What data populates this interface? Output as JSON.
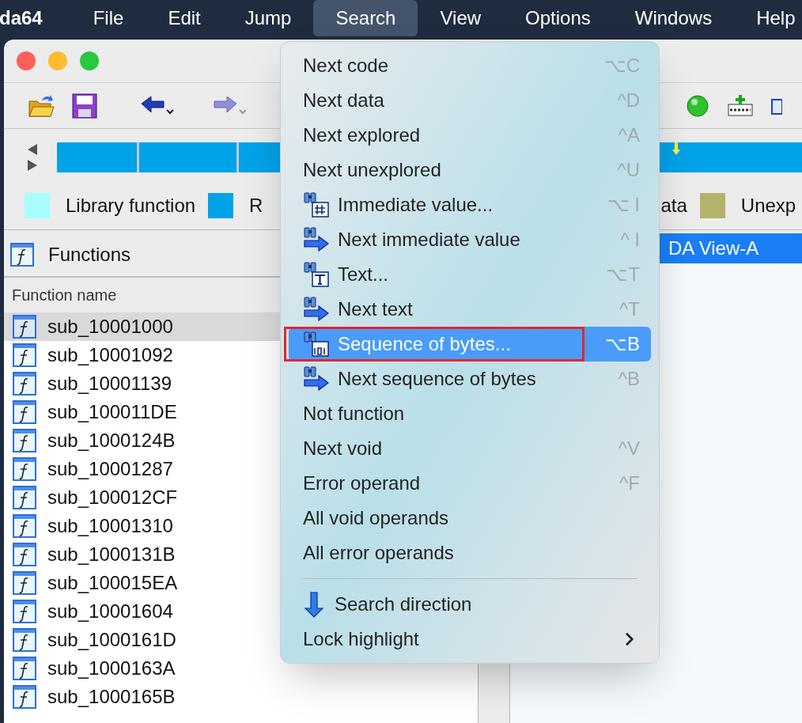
{
  "menubar": [
    {
      "label": "da64",
      "kind": "app",
      "selected": false
    },
    {
      "label": "File",
      "kind": "menu",
      "selected": false
    },
    {
      "label": "Edit",
      "kind": "menu",
      "selected": false
    },
    {
      "label": "Jump",
      "kind": "menu",
      "selected": false
    },
    {
      "label": "Search",
      "kind": "menu",
      "selected": true
    },
    {
      "label": "View",
      "kind": "menu",
      "selected": false
    },
    {
      "label": "Options",
      "kind": "menu",
      "selected": false
    },
    {
      "label": "Windows",
      "kind": "menu",
      "selected": false
    },
    {
      "label": "Help",
      "kind": "menu",
      "selected": false
    }
  ],
  "legend": [
    {
      "label": "Library function",
      "color": "#a8fdfd"
    },
    {
      "label": "R",
      "color": "#00a2e8"
    },
    {
      "label": "ata"
    },
    {
      "label": "Unexp",
      "color": "#b3b36b"
    }
  ],
  "functions_panel": {
    "title": "Functions",
    "column": "Function name",
    "rows": [
      {
        "name": "sub_10001000",
        "selected": true
      },
      {
        "name": "sub_10001092",
        "selected": false
      },
      {
        "name": "sub_10001139",
        "selected": false
      },
      {
        "name": "sub_100011DE",
        "selected": false
      },
      {
        "name": "sub_1000124B",
        "selected": false
      },
      {
        "name": "sub_10001287",
        "selected": false
      },
      {
        "name": "sub_100012CF",
        "selected": false
      },
      {
        "name": "sub_10001310",
        "selected": false
      },
      {
        "name": "sub_1000131B",
        "selected": false
      },
      {
        "name": "sub_100015EA",
        "selected": false
      },
      {
        "name": "sub_10001604",
        "selected": false
      },
      {
        "name": "sub_1000161D",
        "selected": false
      },
      {
        "name": "sub_1000163A",
        "selected": false
      },
      {
        "name": "sub_1000165B",
        "selected": false
      }
    ]
  },
  "view_tab": {
    "label": "DA View-A",
    "selected": true
  },
  "search_menu": [
    {
      "label": "Next code",
      "shortcut": "⌥C",
      "kind": "plain",
      "selected": false
    },
    {
      "label": "Next data",
      "shortcut": "^D",
      "kind": "plain",
      "selected": false
    },
    {
      "label": "Next explored",
      "shortcut": "^A",
      "kind": "plain",
      "selected": false
    },
    {
      "label": "Next unexplored",
      "shortcut": "^U",
      "kind": "plain",
      "selected": false
    },
    {
      "label": "Immediate value...",
      "shortcut": "⌥ I",
      "kind": "hash",
      "selected": false
    },
    {
      "label": "Next immediate value",
      "shortcut": "^ I",
      "kind": "next",
      "selected": false
    },
    {
      "label": "Text...",
      "shortcut": "⌥T",
      "kind": "text",
      "selected": false
    },
    {
      "label": "Next text",
      "shortcut": "^T",
      "kind": "next",
      "selected": false
    },
    {
      "label": "Sequence of bytes...",
      "shortcut": "⌥B",
      "kind": "bytes",
      "selected": true,
      "annotated": true
    },
    {
      "label": "Next sequence of bytes",
      "shortcut": "^B",
      "kind": "next",
      "selected": false
    },
    {
      "label": "Not function",
      "kind": "plain",
      "selected": false
    },
    {
      "label": "Next void",
      "shortcut": "^V",
      "kind": "plain",
      "selected": false
    },
    {
      "label": "Error operand",
      "shortcut": "^F",
      "kind": "plain",
      "selected": false
    },
    {
      "label": "All void operands",
      "kind": "plain",
      "selected": false
    },
    {
      "label": "All error operands",
      "kind": "plain",
      "selected": false,
      "separator_after": true
    },
    {
      "label": "Search direction",
      "kind": "down",
      "selected": false
    },
    {
      "label": "Lock highlight",
      "kind": "plain",
      "selected": false,
      "submenu": true
    }
  ]
}
